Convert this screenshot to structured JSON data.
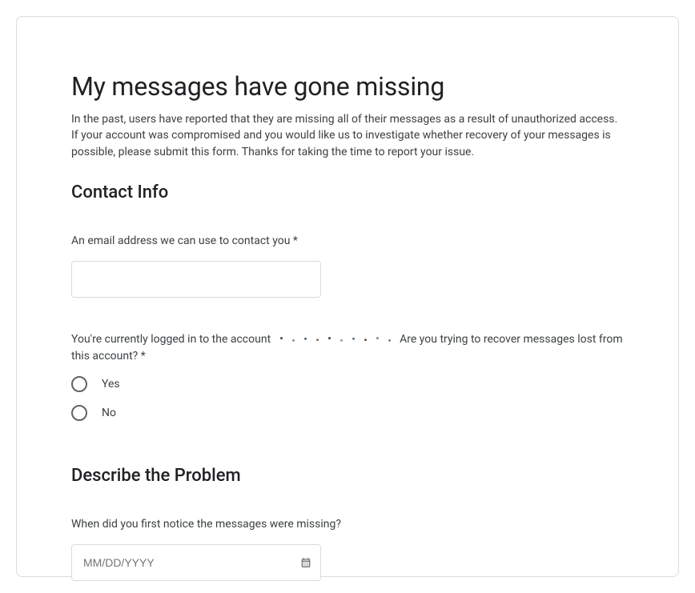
{
  "title": "My messages have gone missing",
  "intro": "In the past, users have reported that they are missing all of their messages as a result of unauthorized access. If your account was compromised and you would like us to investigate whether recovery of your messages is possible, please submit this form. Thanks for taking the time to report your issue.",
  "sections": {
    "contact": {
      "heading": "Contact Info",
      "email_label": "An email address we can use to contact you *",
      "email_value": "",
      "logged_in_prefix": "You're currently logged in to the account ",
      "logged_in_suffix": " Are you trying to recover messages lost from this account? *",
      "radio_yes": "Yes",
      "radio_no": "No"
    },
    "describe": {
      "heading": "Describe the Problem",
      "when_label": "When did you first notice the messages were missing?",
      "date_placeholder": "MM/DD/YYYY"
    }
  }
}
